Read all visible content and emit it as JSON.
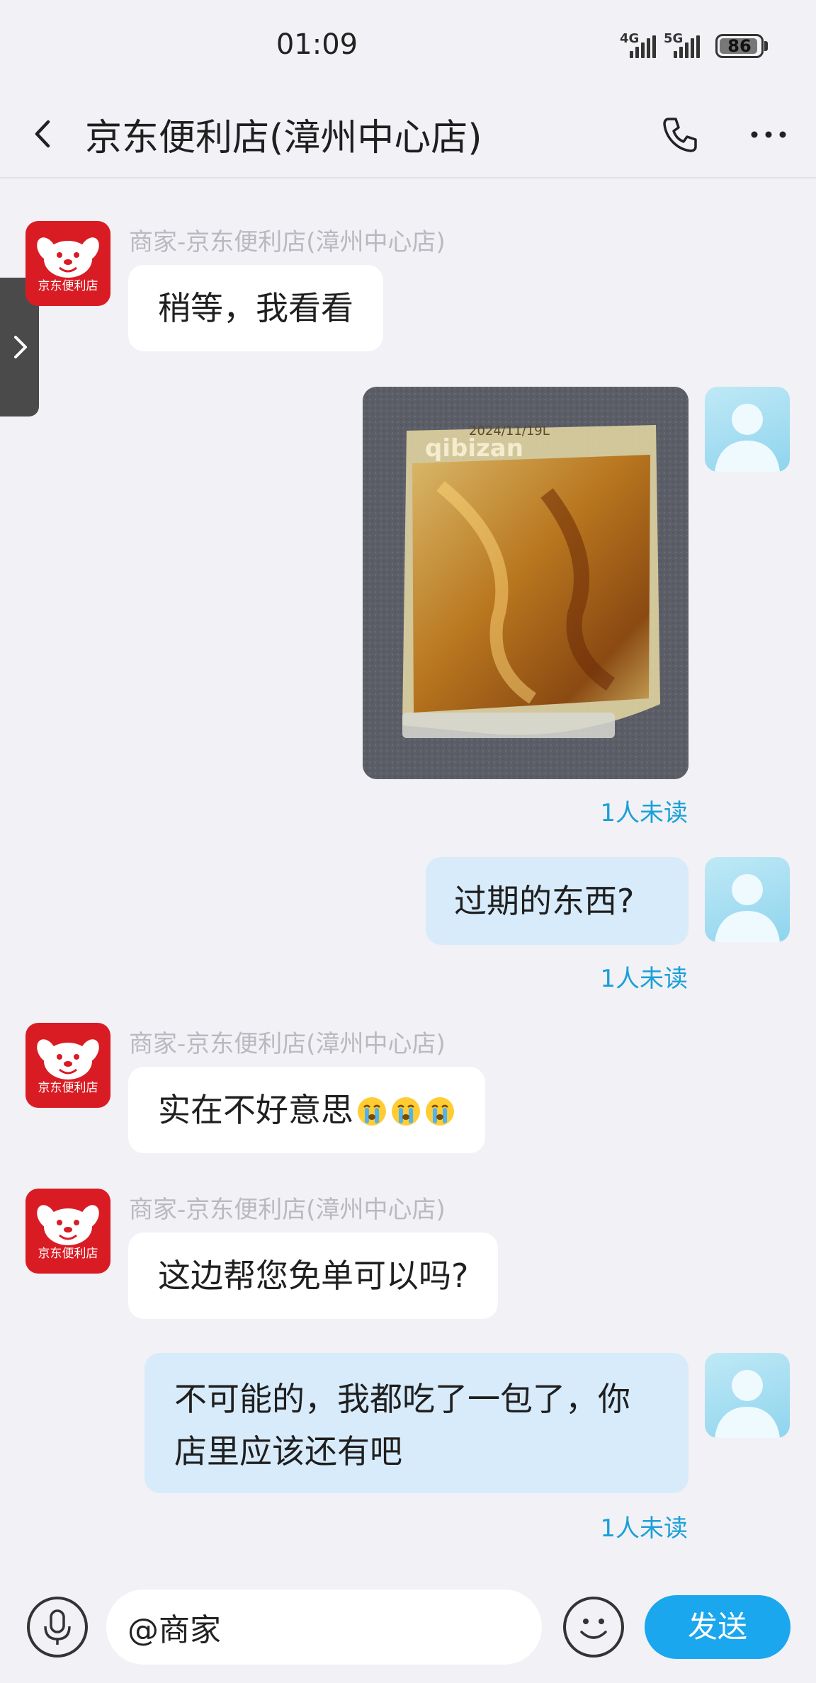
{
  "status_bar": {
    "time": "01:09",
    "network_1": "4G",
    "network_2": "5G",
    "battery": "86"
  },
  "header": {
    "title": "京东便利店(漳州中心店)"
  },
  "messages": [
    {
      "side": "in",
      "sender": "商家-京东便利店(漳州中心店)",
      "text": "稍等，我看看",
      "avatar_label": "京东便利店"
    },
    {
      "side": "out",
      "type": "image",
      "image_text": "2024/11/19L",
      "status": "1人未读"
    },
    {
      "side": "out",
      "text": "过期的东西?",
      "status": "1人未读"
    },
    {
      "side": "in",
      "sender": "商家-京东便利店(漳州中心店)",
      "text": "实在不好意思",
      "avatar_label": "京东便利店"
    },
    {
      "side": "in",
      "sender": "商家-京东便利店(漳州中心店)",
      "text": "这边帮您免单可以吗?",
      "avatar_label": "京东便利店"
    },
    {
      "side": "out",
      "text_line1": "不可能的，我都吃了一包了，你",
      "text_line2": "店里应该还有吧",
      "status": "1人未读"
    }
  ],
  "composer": {
    "value": "@商家",
    "send_label": "发送"
  },
  "colors": {
    "accent": "#1aa7ee",
    "read_status": "#1aa0d8",
    "outgoing_bubble": "#d8ebfb",
    "store_brand": "#d91c24"
  }
}
